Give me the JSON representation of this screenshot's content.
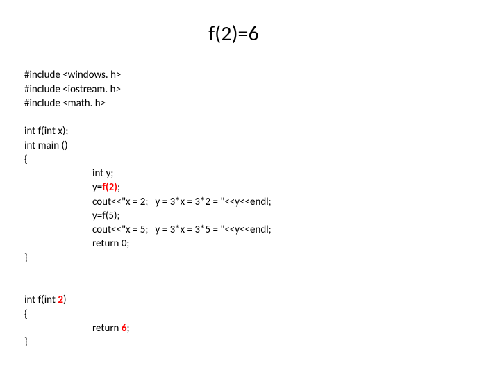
{
  "title": "f(2)=6",
  "code": {
    "inc1": "#include <windows. h>",
    "inc2": "#include <iostream. h>",
    "inc3": "#include <math. h>",
    "proto": "int f(int x);",
    "main_decl": "int main ()",
    "brace_open": "{",
    "l_inty": "int y;",
    "l_yf_pre": "y=",
    "l_yf_call": "f(2)",
    "l_yf_post": ";",
    "l_cout1": "cout<<\"x = 2;   y = 3*x = 3*2 = \"<<y<<endl;",
    "l_yf5": "y=f(5);",
    "l_cout2": "cout<<\"x = 5;   y = 3*x = 3*5 = \"<<y<<endl;",
    "l_ret0": "return 0;",
    "brace_close": "}",
    "fdef_pre": "int f(int ",
    "fdef_arg": "2",
    "fdef_post": ")",
    "brace_open2": "{",
    "l_ret6_pre": "return ",
    "l_ret6_val": "6",
    "l_ret6_post": ";",
    "brace_close2": "}"
  }
}
